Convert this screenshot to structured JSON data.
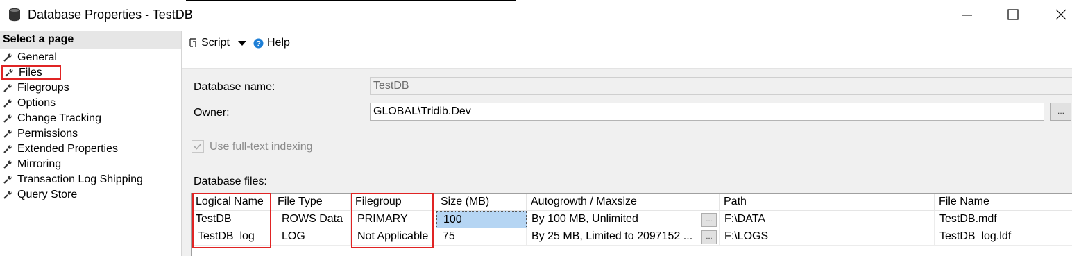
{
  "window": {
    "title": "Database Properties - TestDB",
    "icon": "database-icon",
    "controls": [
      "minimize-icon",
      "maximize-icon",
      "close-icon"
    ]
  },
  "left_pane": {
    "header": "Select a page",
    "items": [
      {
        "label": "General",
        "icon": "wrench-icon"
      },
      {
        "label": "Files",
        "icon": "wrench-icon",
        "selected": true
      },
      {
        "label": "Filegroups",
        "icon": "wrench-icon"
      },
      {
        "label": "Options",
        "icon": "wrench-icon"
      },
      {
        "label": "Change Tracking",
        "icon": "wrench-icon"
      },
      {
        "label": "Permissions",
        "icon": "wrench-icon"
      },
      {
        "label": "Extended Properties",
        "icon": "wrench-icon"
      },
      {
        "label": "Mirroring",
        "icon": "wrench-icon"
      },
      {
        "label": "Transaction Log Shipping",
        "icon": "wrench-icon"
      },
      {
        "label": "Query Store",
        "icon": "wrench-icon"
      }
    ]
  },
  "toolbar": {
    "script_label": "Script",
    "help_label": "Help"
  },
  "form": {
    "database_name_label": "Database name:",
    "database_name_value": "TestDB",
    "owner_label": "Owner:",
    "owner_value": "GLOBAL\\Tridib.Dev",
    "owner_browse": "...",
    "fulltext_label": "Use full-text indexing",
    "fulltext_checked": true,
    "database_files_label": "Database files:"
  },
  "grid": {
    "columns": [
      "Logical Name",
      "File Type",
      "Filegroup",
      "Size (MB)",
      "Autogrowth / Maxsize",
      "Path",
      "File Name"
    ],
    "rows": [
      {
        "logical_name": "TestDB",
        "file_type": "ROWS Data",
        "filegroup": "PRIMARY",
        "size": "100",
        "autogrowth": "By 100 MB, Unlimited",
        "autogrowth_btn": "...",
        "path": "F:\\DATA",
        "file_name": "TestDB.mdf"
      },
      {
        "logical_name": "TestDB_log",
        "file_type": "LOG",
        "filegroup": "Not Applicable",
        "size": "75",
        "autogrowth": "By 25 MB, Limited to 2097152 ...",
        "autogrowth_btn": "...",
        "path": "F:\\LOGS",
        "file_name": "TestDB_log.ldf"
      }
    ]
  },
  "colors": {
    "highlight_red": "#e02424",
    "selected_cell": "#b5d5f3",
    "panel_bg": "#f0f0f0"
  }
}
